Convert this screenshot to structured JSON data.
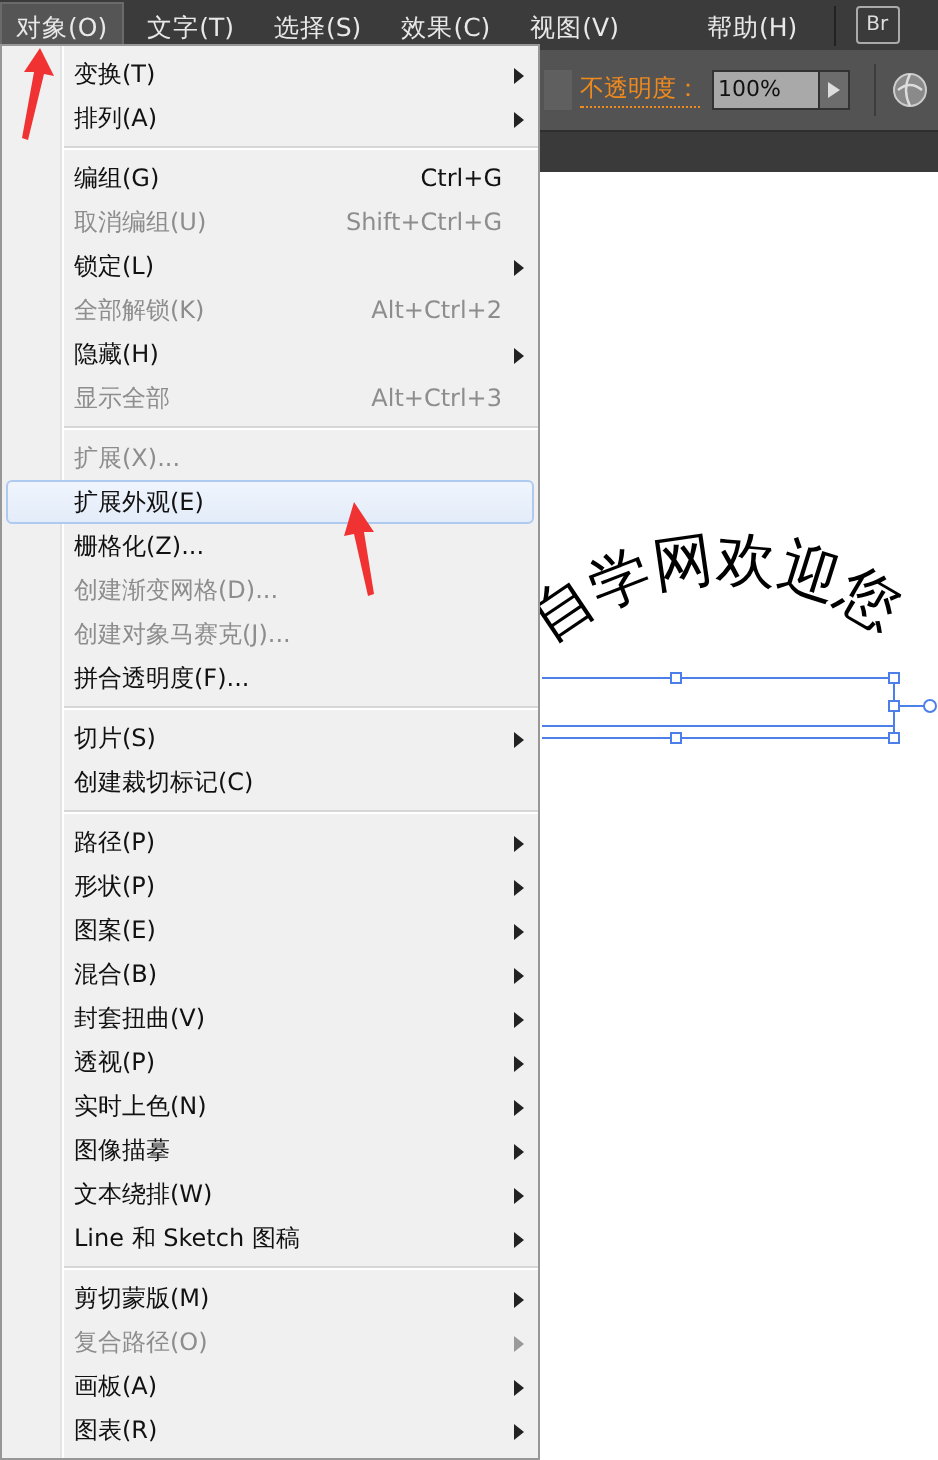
{
  "menubar": [
    {
      "label": "对象(O)",
      "selected": true
    },
    {
      "label": "文字(T)",
      "selected": false
    },
    {
      "label": "选择(S)",
      "selected": false
    },
    {
      "label": "效果(C)",
      "selected": false
    },
    {
      "label": "视图(V)",
      "selected": false
    },
    {
      "label": "帮助(H)",
      "selected": false
    }
  ],
  "toolbar": {
    "opacity_label": "不透明度：",
    "opacity_value": "100%",
    "bridge_button": "Br"
  },
  "menu": [
    {
      "kind": "item",
      "label": "变换(T)",
      "submenu": true,
      "disabled": false,
      "selected": false
    },
    {
      "kind": "item",
      "label": "排列(A)",
      "submenu": true,
      "disabled": false,
      "selected": false
    },
    {
      "kind": "separator"
    },
    {
      "kind": "item",
      "label": "编组(G)",
      "shortcut": "Ctrl+G",
      "submenu": false,
      "disabled": false,
      "selected": false
    },
    {
      "kind": "item",
      "label": "取消编组(U)",
      "shortcut": "Shift+Ctrl+G",
      "submenu": false,
      "disabled": true,
      "selected": false
    },
    {
      "kind": "item",
      "label": "锁定(L)",
      "submenu": true,
      "disabled": false,
      "selected": false
    },
    {
      "kind": "item",
      "label": "全部解锁(K)",
      "shortcut": "Alt+Ctrl+2",
      "submenu": false,
      "disabled": true,
      "selected": false
    },
    {
      "kind": "item",
      "label": "隐藏(H)",
      "submenu": true,
      "disabled": false,
      "selected": false
    },
    {
      "kind": "item",
      "label": "显示全部",
      "shortcut": "Alt+Ctrl+3",
      "submenu": false,
      "disabled": true,
      "selected": false
    },
    {
      "kind": "separator"
    },
    {
      "kind": "item",
      "label": "扩展(X)...",
      "submenu": false,
      "disabled": true,
      "selected": false
    },
    {
      "kind": "item",
      "label": "扩展外观(E)",
      "submenu": false,
      "disabled": false,
      "selected": true
    },
    {
      "kind": "item",
      "label": "栅格化(Z)...",
      "submenu": false,
      "disabled": false,
      "selected": false
    },
    {
      "kind": "item",
      "label": "创建渐变网格(D)...",
      "submenu": false,
      "disabled": true,
      "selected": false
    },
    {
      "kind": "item",
      "label": "创建对象马赛克(J)...",
      "submenu": false,
      "disabled": true,
      "selected": false
    },
    {
      "kind": "item",
      "label": "拼合透明度(F)...",
      "submenu": false,
      "disabled": false,
      "selected": false
    },
    {
      "kind": "separator"
    },
    {
      "kind": "item",
      "label": "切片(S)",
      "submenu": true,
      "disabled": false,
      "selected": false
    },
    {
      "kind": "item",
      "label": "创建裁切标记(C)",
      "submenu": false,
      "disabled": false,
      "selected": false
    },
    {
      "kind": "separator"
    },
    {
      "kind": "item",
      "label": "路径(P)",
      "submenu": true,
      "disabled": false,
      "selected": false
    },
    {
      "kind": "item",
      "label": "形状(P)",
      "submenu": true,
      "disabled": false,
      "selected": false
    },
    {
      "kind": "item",
      "label": "图案(E)",
      "submenu": true,
      "disabled": false,
      "selected": false
    },
    {
      "kind": "item",
      "label": "混合(B)",
      "submenu": true,
      "disabled": false,
      "selected": false
    },
    {
      "kind": "item",
      "label": "封套扭曲(V)",
      "submenu": true,
      "disabled": false,
      "selected": false
    },
    {
      "kind": "item",
      "label": "透视(P)",
      "submenu": true,
      "disabled": false,
      "selected": false
    },
    {
      "kind": "item",
      "label": "实时上色(N)",
      "submenu": true,
      "disabled": false,
      "selected": false
    },
    {
      "kind": "item",
      "label": "图像描摹",
      "submenu": true,
      "disabled": false,
      "selected": false
    },
    {
      "kind": "item",
      "label": "文本绕排(W)",
      "submenu": true,
      "disabled": false,
      "selected": false
    },
    {
      "kind": "item",
      "label": "Line 和 Sketch 图稿",
      "submenu": true,
      "disabled": false,
      "selected": false
    },
    {
      "kind": "separator"
    },
    {
      "kind": "item",
      "label": "剪切蒙版(M)",
      "submenu": true,
      "disabled": false,
      "selected": false
    },
    {
      "kind": "item",
      "label": "复合路径(O)",
      "submenu": true,
      "disabled": true,
      "selected": false
    },
    {
      "kind": "item",
      "label": "画板(A)",
      "submenu": true,
      "disabled": false,
      "selected": false
    },
    {
      "kind": "item",
      "label": "图表(R)",
      "submenu": true,
      "disabled": false,
      "selected": false
    }
  ],
  "canvas": {
    "arc_text": "自学网欢迎您"
  }
}
